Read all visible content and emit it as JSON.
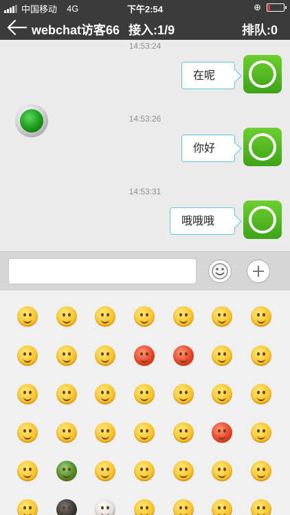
{
  "status_bar": {
    "carrier": "中国移动",
    "network": "4G",
    "time": "下午2:54",
    "lock_glyph": "⊕"
  },
  "header": {
    "title": "webchat访客66",
    "accept": "接入:1/9",
    "queue": "排队:0"
  },
  "chat": {
    "timestamps": [
      "14:53:24",
      "14:53:26",
      "14:53:31"
    ],
    "messages": [
      {
        "text": "在呢"
      },
      {
        "text": "你好"
      },
      {
        "text": "哦哦哦"
      }
    ]
  },
  "input": {
    "placeholder": "",
    "emoji_button_icon": "smiley-icon",
    "plus_button_icon": "plus-icon"
  },
  "colors": {
    "topbar": "#3b3b3b",
    "bubble_border": "#5fc3e3",
    "avatar_green": "#4fb81f"
  }
}
